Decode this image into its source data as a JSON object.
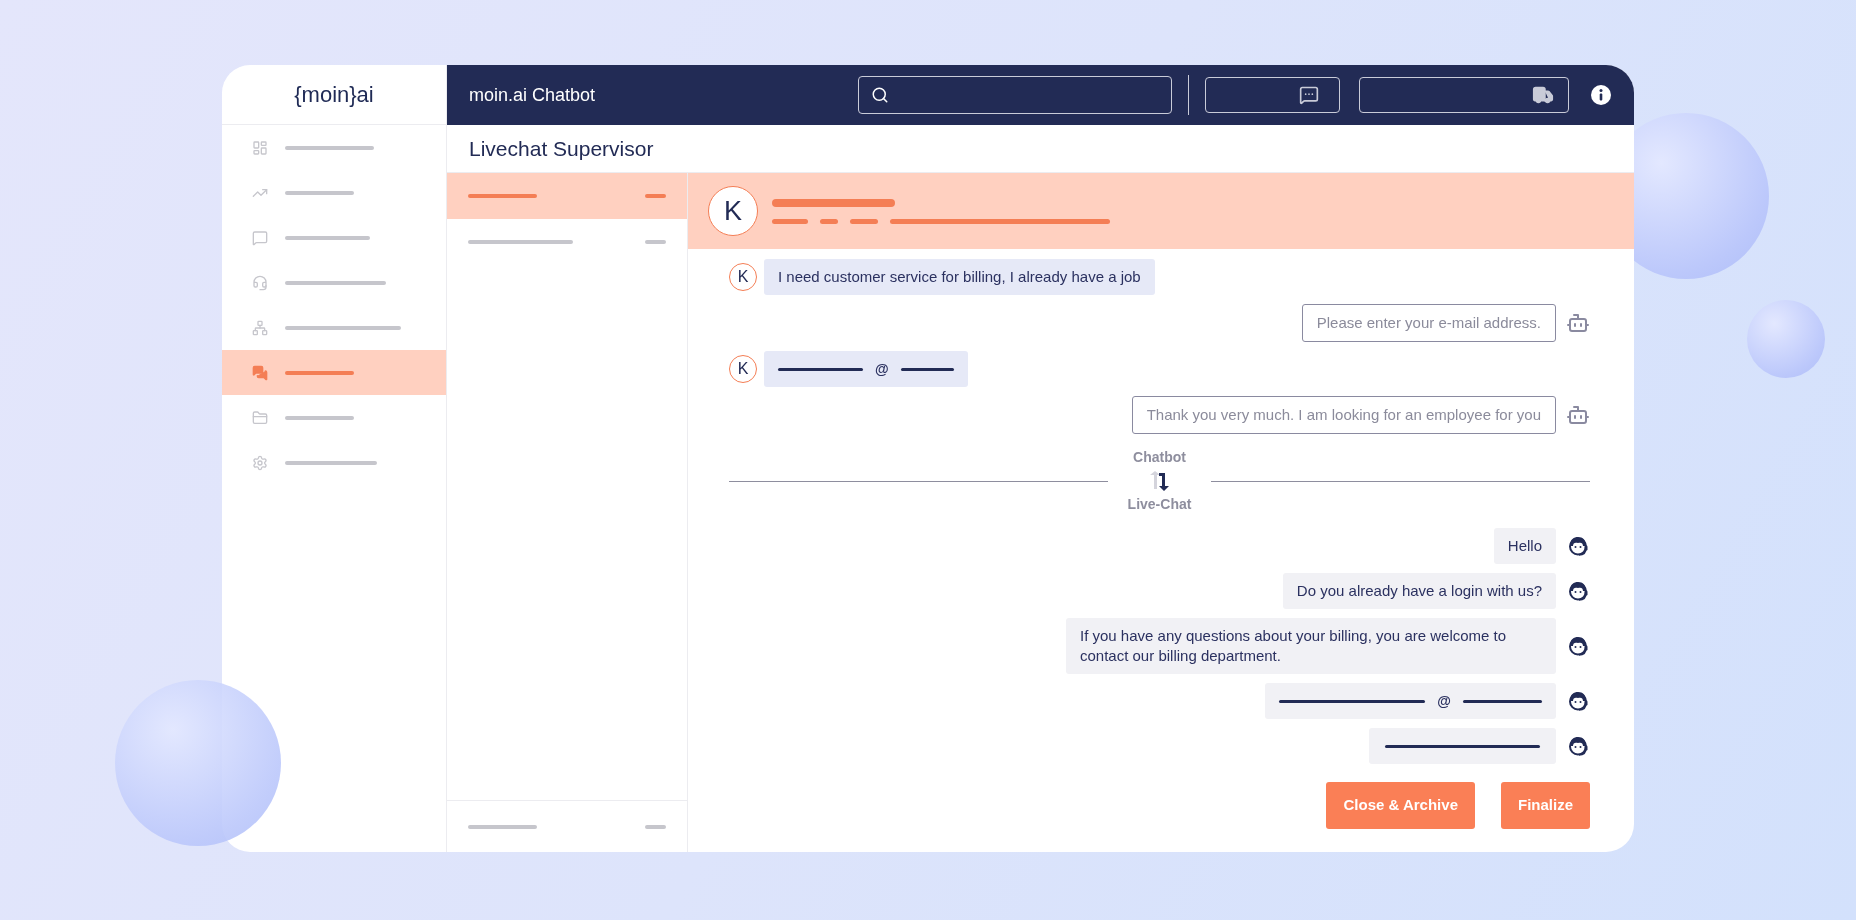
{
  "logo": "{moin}ai",
  "sidebar": {
    "items": [
      {
        "selected": false
      },
      {
        "selected": false
      },
      {
        "selected": false
      },
      {
        "selected": false
      },
      {
        "selected": false
      },
      {
        "selected": true
      },
      {
        "selected": false
      },
      {
        "selected": false
      }
    ]
  },
  "header": {
    "title": "moin.ai Chatbot"
  },
  "page_title": "Livechat Supervisor",
  "conversations": [
    {
      "selected": true
    },
    {
      "selected": false
    }
  ],
  "chat": {
    "avatar": "K",
    "messages": [
      {
        "kind": "customer_text",
        "avatar": "K",
        "text": "I need customer service for billing, I already have a job"
      },
      {
        "kind": "bot_text",
        "text": "Please enter your e-mail address."
      },
      {
        "kind": "customer_email",
        "avatar": "K",
        "text": "@"
      },
      {
        "kind": "bot_text",
        "text": "Thank you very much. I am looking for an employee for you"
      },
      {
        "kind": "handover",
        "from": "Chatbot",
        "to": "Live-Chat"
      },
      {
        "kind": "agent_text",
        "text": "Hello"
      },
      {
        "kind": "agent_text",
        "text": "Do you already have a login with us?"
      },
      {
        "kind": "agent_text",
        "text": "If you have any questions about your billing, you are welcome to contact our billing department."
      },
      {
        "kind": "agent_email",
        "text": "@"
      },
      {
        "kind": "agent_line"
      }
    ],
    "buttons": [
      {
        "label": "Close & Archive"
      },
      {
        "label": "Finalize"
      }
    ]
  }
}
